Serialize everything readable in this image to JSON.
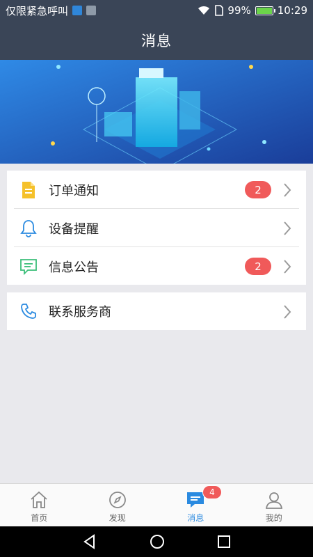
{
  "status_bar": {
    "emergency_text": "仅限紧急呼叫",
    "battery": "99%",
    "time": "10:29",
    "battery_level": 0.99
  },
  "header": {
    "title": "消息"
  },
  "menu": {
    "items": [
      {
        "label": "订单通知",
        "badge": "2",
        "icon": "document-icon"
      },
      {
        "label": "设备提醒",
        "badge": "",
        "icon": "bell-icon"
      },
      {
        "label": "信息公告",
        "badge": "2",
        "icon": "message-icon"
      }
    ],
    "contact": {
      "label": "联系服务商",
      "icon": "phone-icon"
    }
  },
  "tabs": [
    {
      "label": "首页",
      "icon": "home-icon",
      "active": false
    },
    {
      "label": "发现",
      "icon": "compass-icon",
      "active": false
    },
    {
      "label": "消息",
      "icon": "message-icon",
      "active": true,
      "badge": "4"
    },
    {
      "label": "我的",
      "icon": "user-icon",
      "active": false
    }
  ],
  "colors": {
    "header_bg": "#3a4557",
    "accent": "#2a8ae0",
    "badge": "#f05a5a"
  }
}
